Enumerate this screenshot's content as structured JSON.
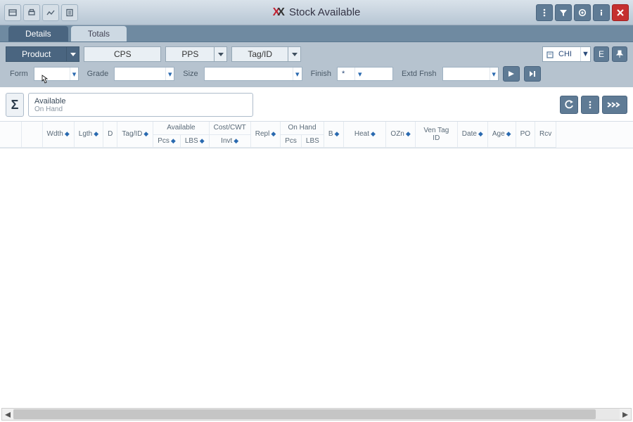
{
  "window": {
    "title": "Stock Available"
  },
  "tabs": {
    "details": "Details",
    "totals": "Totals"
  },
  "segments": {
    "product": "Product",
    "cps": "CPS",
    "pps": "PPS",
    "tagid": "Tag/ID"
  },
  "location_select": {
    "value": "CHI"
  },
  "action_e": "E",
  "filters": {
    "form_label": "Form",
    "form_value": "",
    "grade_label": "Grade",
    "grade_value": "",
    "size_label": "Size",
    "size_value": "",
    "finish_label": "Finish",
    "finish_value": "*",
    "extd_label": "Extd Fnsh",
    "extd_value": ""
  },
  "section": {
    "title": "Available",
    "subtitle": "On Hand"
  },
  "columns": {
    "wdth": "Wdth",
    "lgth": "Lgth",
    "d": "D",
    "tagid": "Tag/ID",
    "available_group": "Available",
    "pcs": "Pcs",
    "lbs": "LBS",
    "costcwt_group": "Cost/CWT",
    "invt": "Invt",
    "repl": "Repl",
    "onhand_group": "On Hand",
    "pcs2": "Pcs",
    "lbs2": "LBS",
    "b": "B",
    "heat": "Heat",
    "ozn": "OZn",
    "ventagid": "Ven Tag ID",
    "date": "Date",
    "age": "Age",
    "po": "PO",
    "rcv": "Rcv"
  }
}
